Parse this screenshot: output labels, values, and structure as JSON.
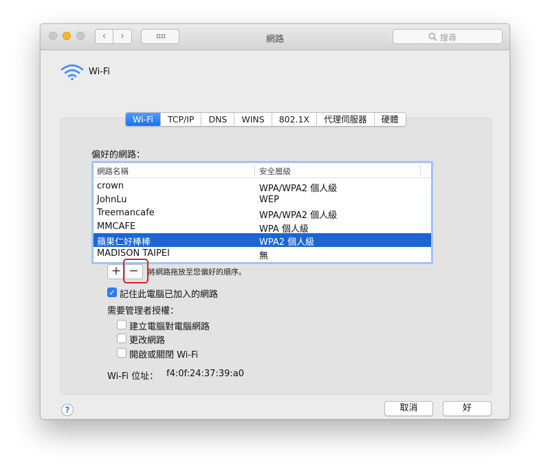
{
  "window": {
    "title": "網路"
  },
  "search": {
    "placeholder": "搜尋"
  },
  "toolbar": {
    "back_glyph": "‹",
    "forward_glyph": "›"
  },
  "header": {
    "service_label": "Wi-Fi"
  },
  "tabs": [
    {
      "label": "Wi-Fi",
      "active": true
    },
    {
      "label": "TCP/IP",
      "active": false
    },
    {
      "label": "DNS",
      "active": false
    },
    {
      "label": "WINS",
      "active": false
    },
    {
      "label": "802.1X",
      "active": false
    },
    {
      "label": "代理伺服器",
      "active": false
    },
    {
      "label": "硬體",
      "active": false
    }
  ],
  "preferred": {
    "label": "偏好的網路：",
    "columns": [
      "網路名稱",
      "安全層級"
    ],
    "rows": [
      {
        "name": "crown",
        "security": "WPA/WPA2 個人級",
        "selected": false
      },
      {
        "name": "JohnLu",
        "security": "WEP",
        "selected": false
      },
      {
        "name": "Treemancafe",
        "security": "WPA/WPA2 個人級",
        "selected": false
      },
      {
        "name": "MMCAFE",
        "security": "WPA 個人級",
        "selected": false
      },
      {
        "name": "蘋果仁好棒棒",
        "security": "WPA2 個人級",
        "selected": true
      },
      {
        "name": "MADISON TAIPEI",
        "security": "無",
        "selected": false
      }
    ],
    "add_label": "+",
    "remove_label": "−",
    "drag_hint": "將網路拖放至您偏好的順序。"
  },
  "remember": {
    "label": "記住此電腦已加入的網路",
    "checked": true
  },
  "admin": {
    "label": "需要管理者授權：",
    "options": [
      {
        "label": "建立電腦對電腦網路",
        "checked": false
      },
      {
        "label": "更改網路",
        "checked": false
      },
      {
        "label": "開啟或關閉 Wi-Fi",
        "checked": false
      }
    ]
  },
  "mac": {
    "label": "Wi-Fi 位址：",
    "value": "f4:0f:24:37:39:a0"
  },
  "footer": {
    "help": "?",
    "cancel": "取消",
    "ok": "好"
  },
  "colors": {
    "accent": "#1f6ef3",
    "selection": "#1b66d4",
    "highlight_box": "#e02020"
  }
}
